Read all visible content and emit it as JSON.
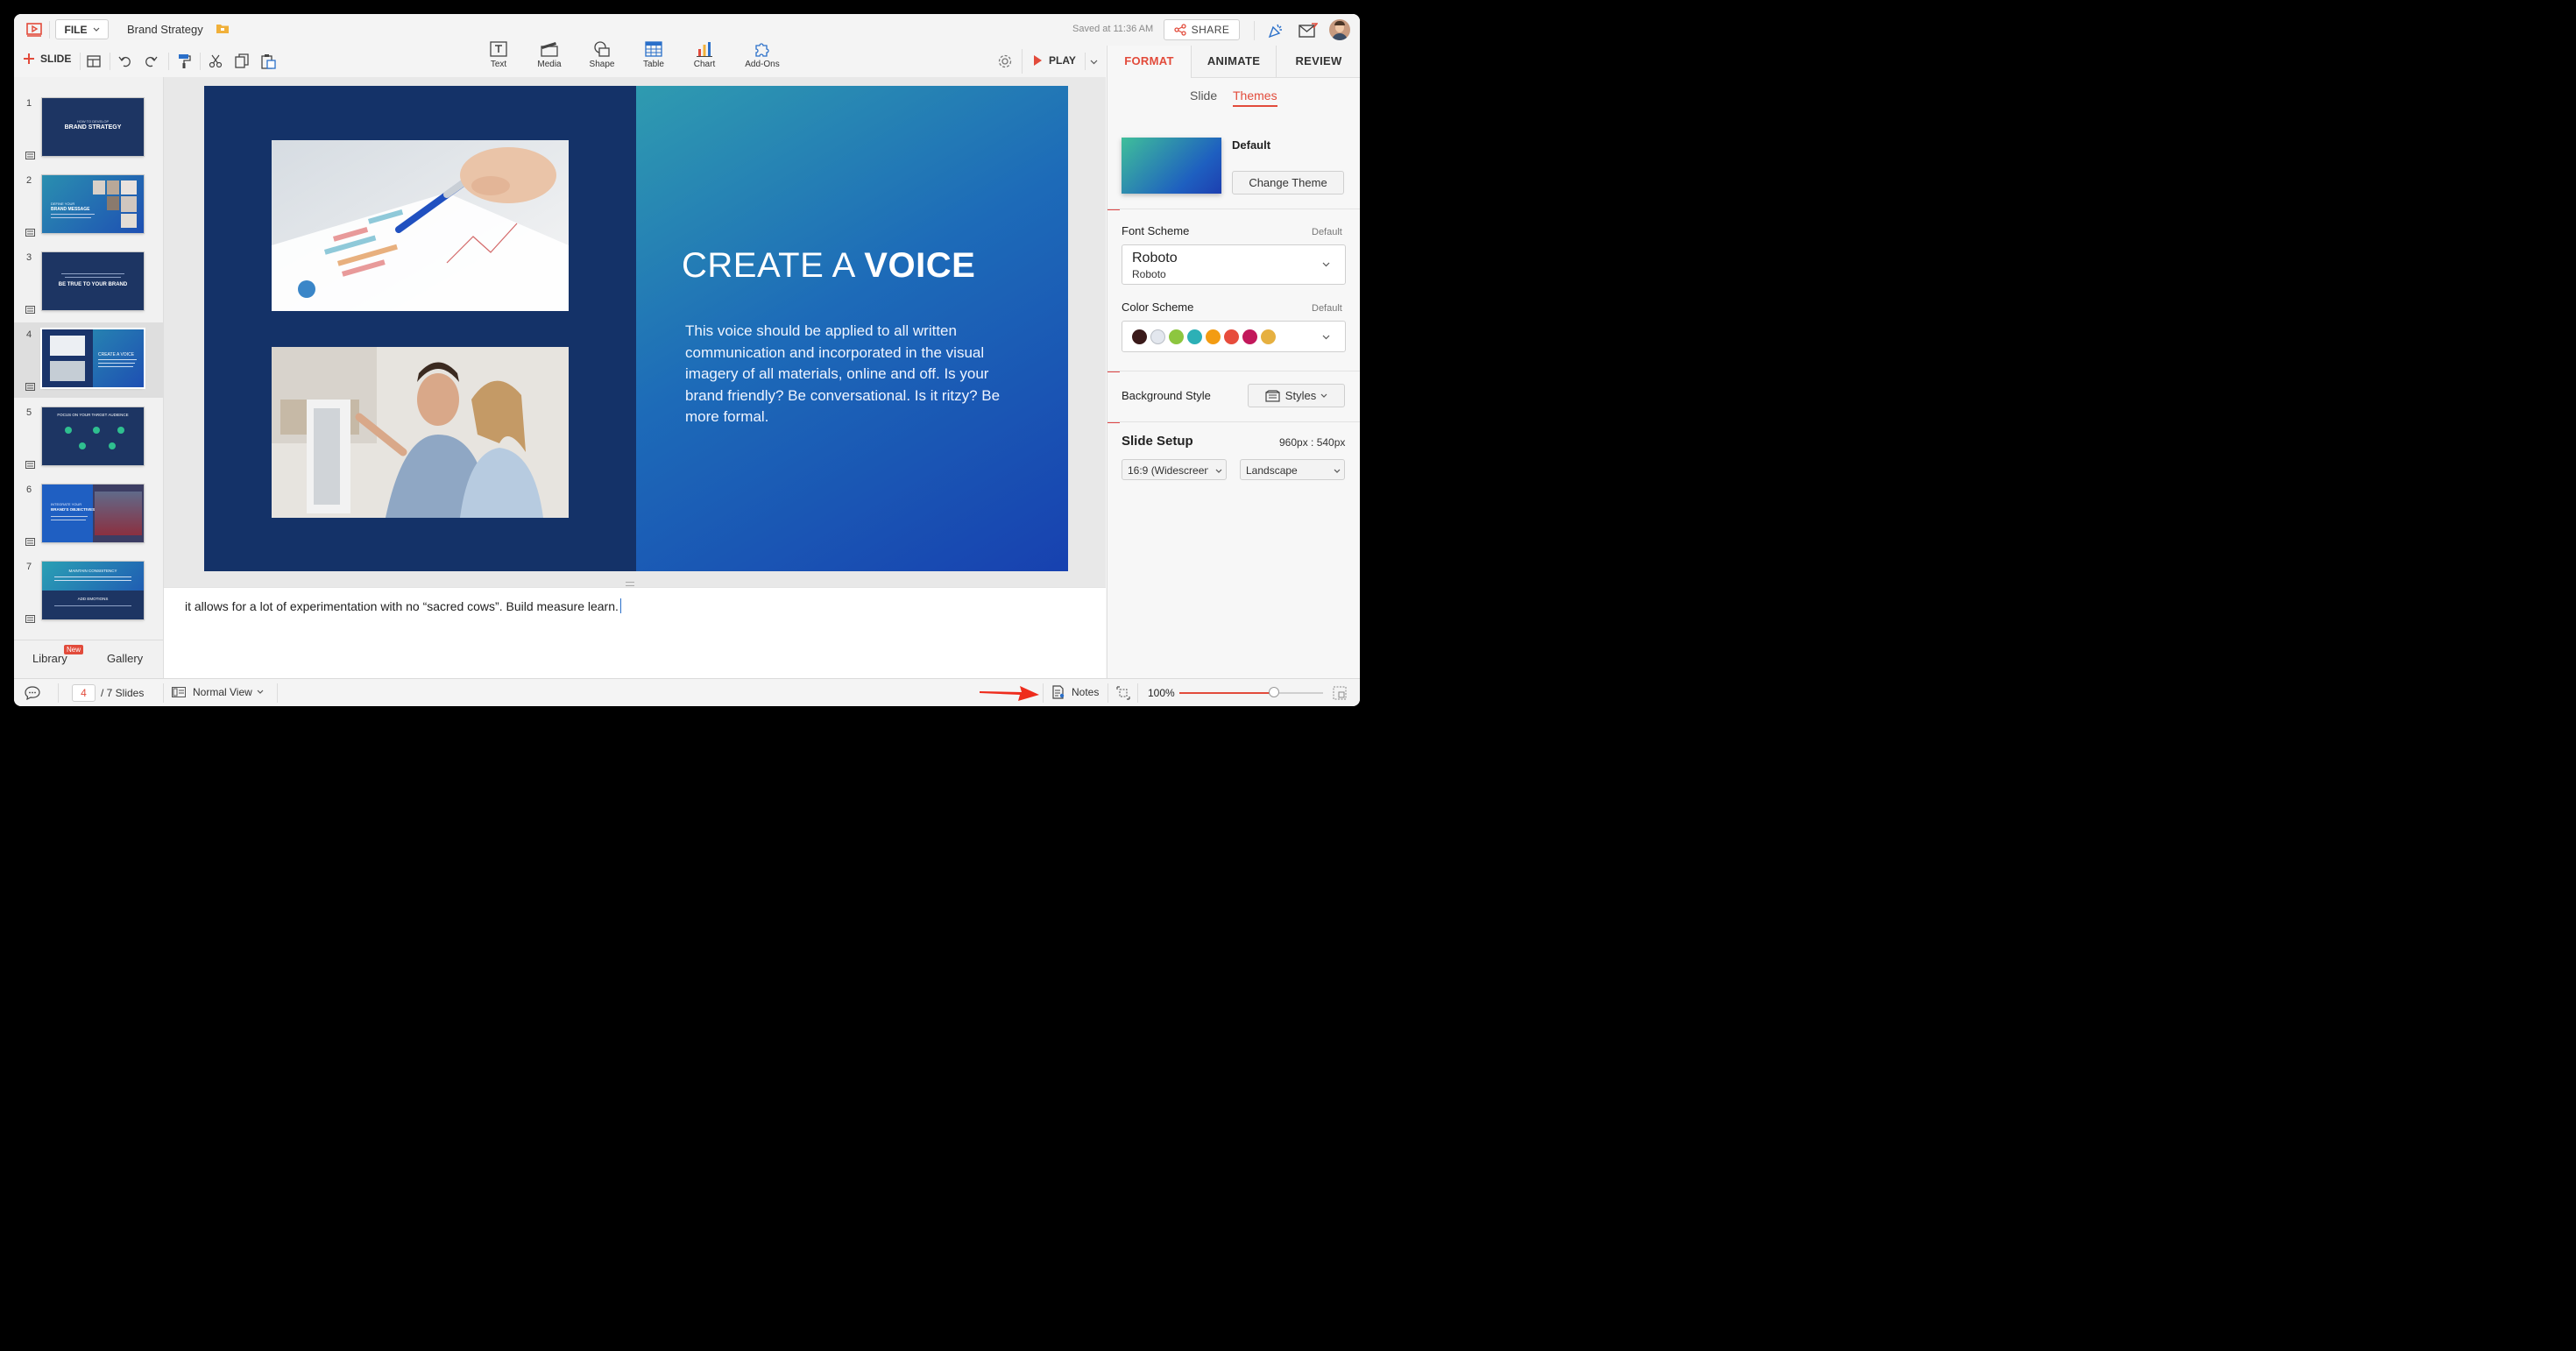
{
  "app": {
    "file_menu": "FILE",
    "doc_title": "Brand Strategy",
    "saved": "Saved at 11:36 AM",
    "share": "SHARE"
  },
  "toolbar": {
    "slide_btn": "SLIDE",
    "play": "PLAY",
    "tools": [
      {
        "label": "Text"
      },
      {
        "label": "Media"
      },
      {
        "label": "Shape"
      },
      {
        "label": "Table"
      },
      {
        "label": "Chart"
      },
      {
        "label": "Add-Ons"
      }
    ]
  },
  "panel": {
    "tabs": [
      "FORMAT",
      "ANIMATE",
      "REVIEW"
    ],
    "subtabs": [
      "Slide",
      "Themes"
    ],
    "theme_name": "Default",
    "change_theme": "Change Theme",
    "font_scheme_label": "Font Scheme",
    "font_scheme_default": "Default",
    "font_primary": "Roboto",
    "font_secondary": "Roboto",
    "color_scheme_label": "Color Scheme",
    "color_scheme_default": "Default",
    "colors": [
      "#3a1a1a",
      "#e3e7ee",
      "#8dc63f",
      "#2cb0b6",
      "#f39c12",
      "#e74c3c",
      "#c2185b",
      "#e6b040"
    ],
    "bg_style_label": "Background Style",
    "styles_btn": "Styles",
    "slide_setup_label": "Slide Setup",
    "slide_size": "960px : 540px",
    "aspect": "16:9 (Widescreen)",
    "orientation": "Landscape"
  },
  "slides": [
    {
      "num": "1",
      "sub": "HOW TO DEVELOP",
      "title": "BRAND STRATEGY"
    },
    {
      "num": "2",
      "sub": "DEFINE YOUR",
      "title": "BRAND MESSAGE"
    },
    {
      "num": "3",
      "sub": "",
      "title": "BE TRUE TO YOUR BRAND"
    },
    {
      "num": "4",
      "sub": "",
      "title": "CREATE A VOICE"
    },
    {
      "num": "5",
      "sub": "",
      "title": "FOCUS ON YOUR TARGET AUDIENCE"
    },
    {
      "num": "6",
      "sub": "INTEGRATE YOUR",
      "title": "BRAND'S OBJECTIVES"
    },
    {
      "num": "7",
      "sub": "MAINTAIN CONSISTENCY",
      "title": "ADD EMOTIONS"
    }
  ],
  "current_slide": {
    "title_light": "CREATE A ",
    "title_bold": "VOICE",
    "body": "This voice should be applied to all written communication and incorporated in the visual imagery of all materials, online and off. Is your brand friendly? Be conversational. Is it ritzy? Be more formal."
  },
  "notes_text": "it allows for a lot of experimentation with no “sacred cows”. Build measure learn.",
  "library": {
    "library": "Library",
    "new_badge": "New",
    "gallery": "Gallery"
  },
  "status": {
    "page": "4",
    "total": "/ 7 Slides",
    "view": "Normal View",
    "notes": "Notes",
    "zoom": "100%",
    "zoom_fraction": 0.66
  }
}
